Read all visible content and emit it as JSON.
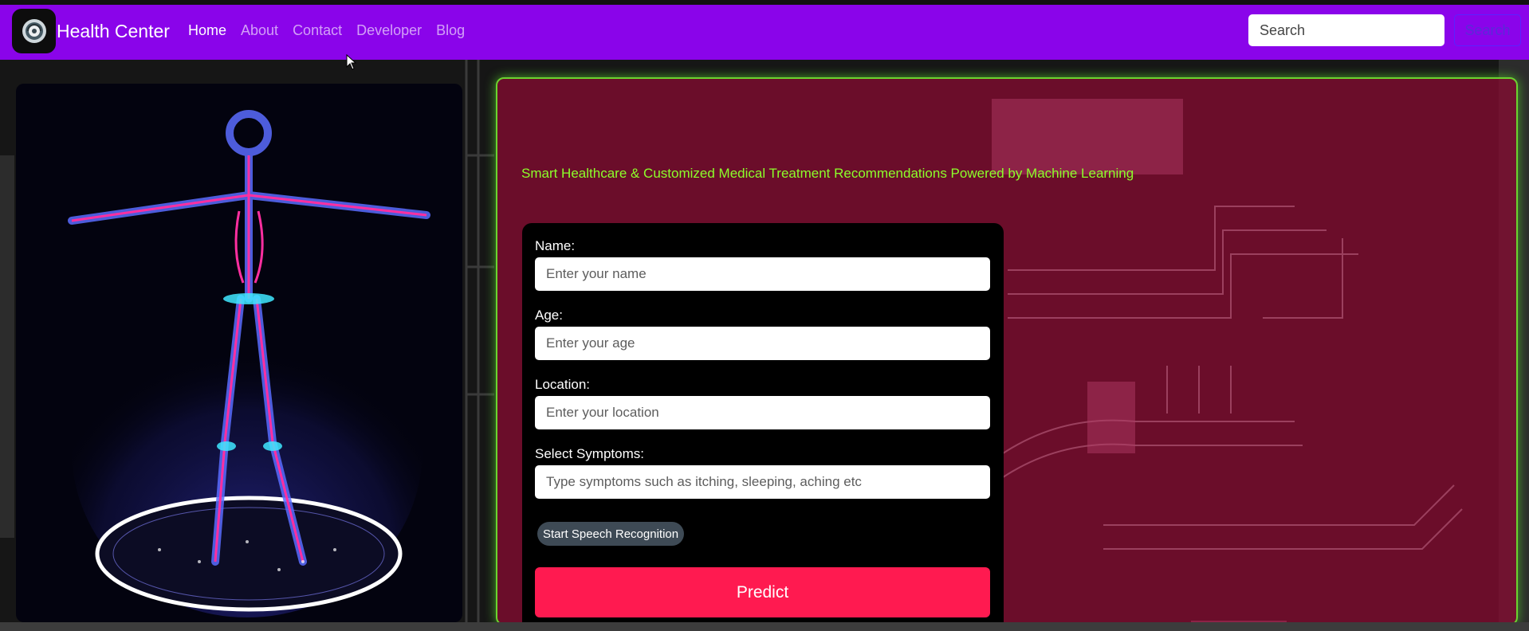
{
  "navbar": {
    "brand": "Health Center",
    "links": [
      {
        "label": "Home",
        "active": true
      },
      {
        "label": "About",
        "active": false
      },
      {
        "label": "Contact",
        "active": false
      },
      {
        "label": "Developer",
        "active": false
      },
      {
        "label": "Blog",
        "active": false
      }
    ],
    "search_placeholder": "Search",
    "search_button": "Search",
    "colors": {
      "background": "#8a04ea"
    }
  },
  "hero": {
    "tagline": "Smart Healthcare & Customized Medical Treatment Recommendations Powered by Machine Learning",
    "tagline_color": "#8cff2a"
  },
  "form": {
    "name": {
      "label": "Name:",
      "placeholder": "Enter your name"
    },
    "age": {
      "label": "Age:",
      "placeholder": "Enter your age"
    },
    "location": {
      "label": "Location:",
      "placeholder": "Enter your location"
    },
    "symptoms": {
      "label": "Select Symptoms:",
      "placeholder": "Type symptoms such as itching, sleeping, aching etc"
    },
    "speech_button": "Start Speech Recognition",
    "predict_button": "Predict",
    "colors": {
      "predict": "#ff1a50",
      "card": "#000000"
    }
  },
  "icons": {
    "logo": "health-logo-icon",
    "hologram": "human-body-hologram",
    "cursor": "mouse-cursor-icon"
  }
}
